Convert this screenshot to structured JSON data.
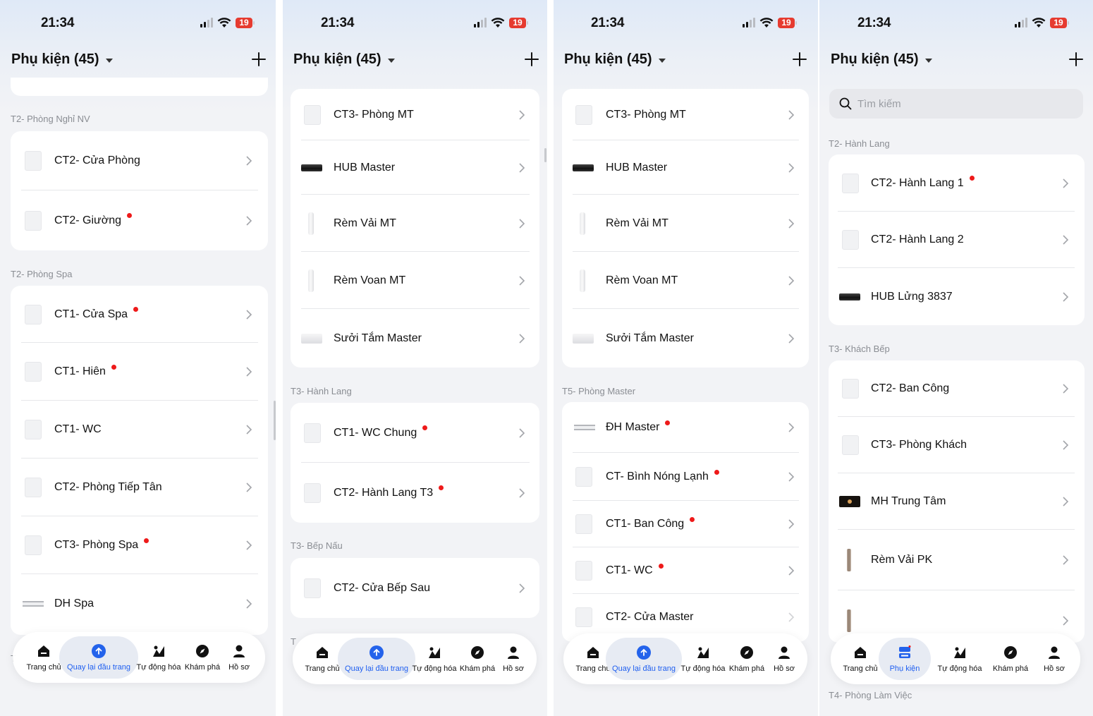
{
  "status": {
    "time": "21:34",
    "battery": "19"
  },
  "header": {
    "title": "Phụ kiện (45)"
  },
  "tabs": {
    "home": "Trang chủ",
    "back_top": "Quay lại đầu trang",
    "automation": "Tự động hóa",
    "explore": "Khám phá",
    "profile": "Hồ sơ",
    "accessories": "Phụ kiện"
  },
  "screen1": {
    "sections": [
      "T2- Phòng Nghỉ NV",
      "T2- Phòng Spa"
    ],
    "cut_label": "T",
    "card1": [
      {
        "name": "CT2- Cửa Phòng",
        "icon": "box"
      },
      {
        "name": "CT2- Giường",
        "icon": "box",
        "dot": true
      }
    ],
    "card2": [
      {
        "name": "CT1- Cửa Spa",
        "icon": "box",
        "dot": true
      },
      {
        "name": "CT1- Hiên",
        "icon": "box",
        "dot": true
      },
      {
        "name": "CT1- WC",
        "icon": "box"
      },
      {
        "name": "CT2- Phòng Tiếp Tân",
        "icon": "box"
      },
      {
        "name": "CT3- Phòng Spa",
        "icon": "box",
        "dot": true
      },
      {
        "name": "DH Spa",
        "icon": "ac"
      }
    ]
  },
  "screen2": {
    "sections": [
      "T3- Hành Lang",
      "T3- Bếp Nấu"
    ],
    "cut_label": "T",
    "card1": [
      {
        "name": "CT3- Phòng MT",
        "icon": "box"
      },
      {
        "name": "HUB Master",
        "icon": "hub"
      },
      {
        "name": "Rèm Vải MT",
        "icon": "curtain"
      },
      {
        "name": "Rèm Voan MT",
        "icon": "curtain"
      },
      {
        "name": "Sưởi Tắm Master",
        "icon": "heater"
      }
    ],
    "card2": [
      {
        "name": "CT1- WC Chung",
        "icon": "box",
        "dot": true
      },
      {
        "name": "CT2- Hành Lang T3",
        "icon": "box",
        "dot": true
      }
    ],
    "card3": [
      {
        "name": "CT2- Cửa Bếp Sau",
        "icon": "box"
      }
    ]
  },
  "screen3": {
    "sections": [
      "T5- Phòng Master"
    ],
    "card1": [
      {
        "name": "CT3- Phòng MT",
        "icon": "box"
      },
      {
        "name": "HUB Master",
        "icon": "hub"
      },
      {
        "name": "Rèm Vải MT",
        "icon": "curtain"
      },
      {
        "name": "Rèm Voan MT",
        "icon": "curtain"
      },
      {
        "name": "Sưởi Tắm Master",
        "icon": "heater"
      }
    ],
    "card2": [
      {
        "name": "ĐH Master",
        "icon": "ac",
        "dot": true
      },
      {
        "name": "CT- Bình Nóng Lạnh",
        "icon": "box",
        "dot": true
      },
      {
        "name": "CT1- Ban Công",
        "icon": "box",
        "dot": true
      },
      {
        "name": "CT1- WC",
        "icon": "box",
        "dot": true
      },
      {
        "name": "CT2- Cửa Master",
        "icon": "box"
      }
    ]
  },
  "screen4": {
    "search_placeholder": "Tìm kiếm",
    "sections": [
      "T2- Hành Lang",
      "T3- Khách Bếp",
      "T4- Phòng Làm Việc"
    ],
    "card1": [
      {
        "name": "CT2- Hành Lang 1",
        "icon": "box",
        "dot": true
      },
      {
        "name": "CT2- Hành Lang 2",
        "icon": "box"
      },
      {
        "name": "HUB Lửng 3837",
        "icon": "hub"
      }
    ],
    "card2": [
      {
        "name": "CT2- Ban Công",
        "icon": "box"
      },
      {
        "name": "CT3- Phòng Khách",
        "icon": "box"
      },
      {
        "name": "MH Trung Tâm",
        "icon": "mh"
      },
      {
        "name": "Rèm Vải PK",
        "icon": "curtain-brown"
      },
      {
        "name": "",
        "icon": "curtain-brown"
      }
    ]
  }
}
